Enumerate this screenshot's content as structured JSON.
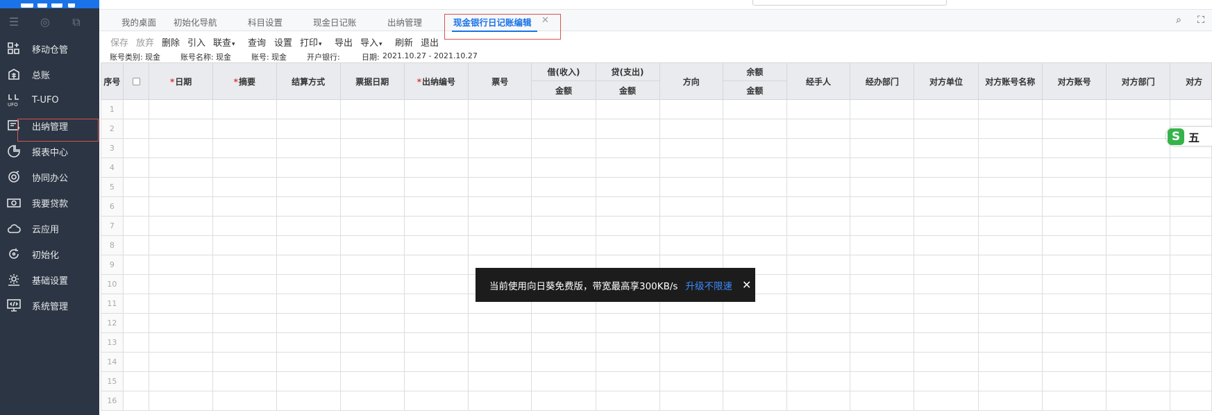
{
  "sidebar": {
    "items": [
      {
        "label": "移动仓管",
        "icon": "warehouse-icon"
      },
      {
        "label": "总账",
        "icon": "ledger-icon"
      },
      {
        "label": "T-UFO",
        "icon": "ufo-icon"
      },
      {
        "label": "出纳管理",
        "icon": "cashier-icon"
      },
      {
        "label": "报表中心",
        "icon": "pie-chart-icon"
      },
      {
        "label": "协同办公",
        "icon": "collaboration-icon"
      },
      {
        "label": "我要贷款",
        "icon": "money-icon"
      },
      {
        "label": "云应用",
        "icon": "cloud-icon"
      },
      {
        "label": "初始化",
        "icon": "refresh-icon"
      },
      {
        "label": "基础设置",
        "icon": "settings-icon"
      },
      {
        "label": "系统管理",
        "icon": "code-monitor-icon"
      }
    ]
  },
  "tabs": [
    {
      "label": "我的桌面"
    },
    {
      "label": "初始化导航"
    },
    {
      "label": "科目设置"
    },
    {
      "label": "现金日记账"
    },
    {
      "label": "出纳管理"
    },
    {
      "label": "现金银行日记账编辑",
      "active": true
    }
  ],
  "tab_close": "✕",
  "toolbar": {
    "save": "保存",
    "discard": "放弃",
    "delete": "删除",
    "import_ref": "引入",
    "linked_query": "联查",
    "query": "查询",
    "settings": "设置",
    "print": "打印",
    "export": "导出",
    "import": "导入",
    "refresh": "刷新",
    "exit": "退出"
  },
  "info": {
    "account_type_label": "账号类别:",
    "account_type_value": "现金",
    "account_name_label": "账号名称:",
    "account_name_value": "现金",
    "account_no_label": "账号:",
    "account_no_value": "现金",
    "bank_label": "开户银行:",
    "date_label": "日期:",
    "date_value": "2021.10.27 - 2021.10.27"
  },
  "grid": {
    "headers": {
      "seq": "序号",
      "date": "日期",
      "summary": "摘要",
      "settle_method": "结算方式",
      "bill_date": "票据日期",
      "cashier_no": "出纳编号",
      "bill_no": "票号",
      "debit": "借(收入)",
      "credit": "贷(支出)",
      "direction": "方向",
      "balance": "余额",
      "amount": "金额",
      "handler": "经手人",
      "handling_dept": "经办部门",
      "counter_unit": "对方单位",
      "counter_acc_name": "对方账号名称",
      "counter_acc": "对方账号",
      "counter_dept": "对方部门",
      "counter_cut": "对方"
    },
    "row_numbers": [
      "1",
      "2",
      "3",
      "4",
      "5",
      "6",
      "7",
      "8",
      "9",
      "10",
      "11",
      "12",
      "13",
      "14",
      "15",
      "16"
    ]
  },
  "toast": {
    "message": "当前使用向日葵免费版，带宽最高享300KB/s",
    "link": "升级不限速",
    "close": "✕"
  },
  "ime": {
    "logo": "S",
    "text": "五"
  },
  "colors": {
    "sidebar_bg": "#2c3543",
    "accent": "#1a73e8",
    "highlight_outline": "#d9534f",
    "header_bg": "#e9ebee"
  }
}
